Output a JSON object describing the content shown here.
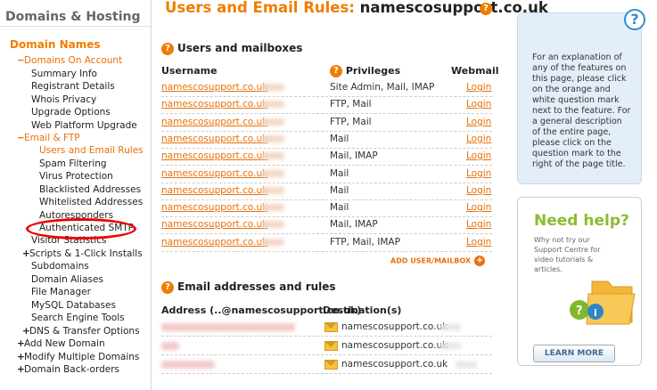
{
  "sidebar": {
    "header": "Domains & Hosting",
    "section": "Domain Names",
    "items": [
      {
        "label": "Domains On Account",
        "prefix": "−",
        "style": "orange"
      },
      {
        "label": "Summary Info",
        "prefix": "",
        "style": "plain"
      },
      {
        "label": "Registrant Details",
        "prefix": "",
        "style": "plain"
      },
      {
        "label": "Whois Privacy",
        "prefix": "",
        "style": "plain"
      },
      {
        "label": "Upgrade Options",
        "prefix": "",
        "style": "plain"
      },
      {
        "label": "Web Platform Upgrade",
        "prefix": "",
        "style": "plain"
      },
      {
        "label": "Email & FTP",
        "prefix": "−",
        "style": "orange"
      },
      {
        "label": "Users and Email Rules",
        "prefix": "",
        "style": "active"
      },
      {
        "label": "Spam Filtering",
        "prefix": "",
        "style": "plain"
      },
      {
        "label": "Virus Protection",
        "prefix": "",
        "style": "plain"
      },
      {
        "label": "Blacklisted Addresses",
        "prefix": "",
        "style": "plain"
      },
      {
        "label": "Whitelisted Addresses",
        "prefix": "",
        "style": "plain"
      },
      {
        "label": "Autoresponders",
        "prefix": "",
        "style": "plain"
      },
      {
        "label": "Authenticated SMTP",
        "prefix": "",
        "style": "plain"
      },
      {
        "label": "Visitor Statistics",
        "prefix": "",
        "style": "plain"
      },
      {
        "label": "Scripts & 1-Click Installs",
        "prefix": "+",
        "style": "plain"
      },
      {
        "label": "Subdomains",
        "prefix": "",
        "style": "plain"
      },
      {
        "label": "Domain Aliases",
        "prefix": "",
        "style": "plain"
      },
      {
        "label": "File Manager",
        "prefix": "",
        "style": "plain"
      },
      {
        "label": "MySQL Databases",
        "prefix": "",
        "style": "plain"
      },
      {
        "label": "Search Engine Tools",
        "prefix": "",
        "style": "plain"
      },
      {
        "label": "DNS & Transfer Options",
        "prefix": "+",
        "style": "plain"
      },
      {
        "label": "Add New Domain",
        "prefix": "+",
        "style": "plain"
      },
      {
        "label": "Modify Multiple Domains",
        "prefix": "+",
        "style": "plain"
      },
      {
        "label": "Domain Back-orders",
        "prefix": "+",
        "style": "plain"
      }
    ]
  },
  "main": {
    "title": "Users and Email Rules:",
    "title_domain": "namescosupport.co.uk",
    "users_heading": "Users and mailboxes",
    "col_username": "Username",
    "col_privileges": "Privileges",
    "col_webmail": "Webmail",
    "users": [
      {
        "username": "namescosupport.co.uk",
        "privileges": "Site Admin, Mail, IMAP",
        "webmail": "Login"
      },
      {
        "username": "namescosupport.co.uk",
        "privileges": "FTP, Mail",
        "webmail": "Login"
      },
      {
        "username": "namescosupport.co.uk",
        "privileges": "FTP, Mail",
        "webmail": "Login"
      },
      {
        "username": "namescosupport.co.uk",
        "privileges": "Mail",
        "webmail": "Login"
      },
      {
        "username": "namescosupport.co.uk",
        "privileges": "Mail, IMAP",
        "webmail": "Login"
      },
      {
        "username": "namescosupport.co.uk",
        "privileges": "Mail",
        "webmail": "Login"
      },
      {
        "username": "namescosupport.co.uk",
        "privileges": "Mail",
        "webmail": "Login"
      },
      {
        "username": "namescosupport.co.uk",
        "privileges": "Mail",
        "webmail": "Login"
      },
      {
        "username": "namescosupport.co.uk",
        "privileges": "Mail, IMAP",
        "webmail": "Login"
      },
      {
        "username": "namescosupport.co.uk",
        "privileges": "FTP, Mail, IMAP",
        "webmail": "Login"
      }
    ],
    "add_user_label": "ADD USER/MAILBOX",
    "email_heading": "Email addresses and rules",
    "col_address": "Address (..@namescosupport.co.uk)",
    "col_destination": "Destination(s)",
    "rules": [
      {
        "destination": "namescosupport.co.uk"
      },
      {
        "destination": "namescosupport.co.uk"
      },
      {
        "destination": "namescosupport.co.uk"
      }
    ]
  },
  "info": {
    "text": "For an explanation of any of the features on this page, please click on the orange and white question mark next to the feature. For a general description of the entire page, please click on the question mark to the right of the page title."
  },
  "help": {
    "heading": "Need help?",
    "text": "Why not try our Support Centre for video tutorials & articles.",
    "button": "LEARN MORE"
  },
  "colors": {
    "accent": "#f07d00",
    "link": "#e8700a",
    "help_green": "#8bbd2f",
    "info_bg": "#e3eef9"
  }
}
